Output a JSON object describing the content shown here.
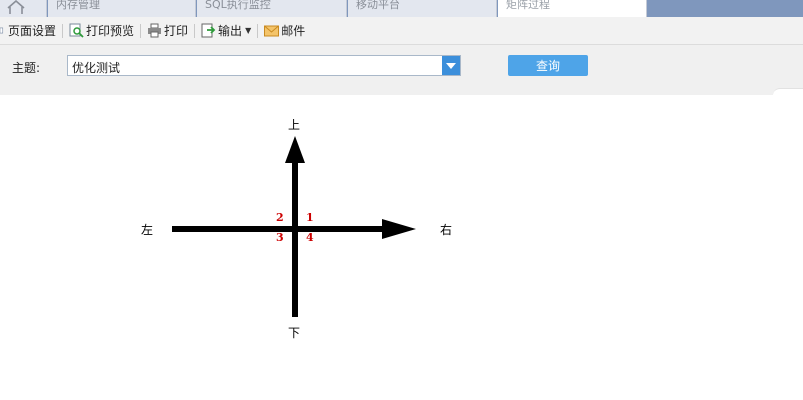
{
  "tabs": [
    {
      "label": ""
    },
    {
      "label": "内存管理"
    },
    {
      "label": "SQL执行监控"
    },
    {
      "label": "移动平台"
    },
    {
      "label": "矩阵过程"
    }
  ],
  "toolbar": {
    "page_setup": "页面设置",
    "print_preview": "打印预览",
    "print": "打印",
    "export": "输出",
    "mail": "邮件"
  },
  "filter": {
    "label": "主题:",
    "selected": "优化测试",
    "query_button": "查询"
  },
  "diagram": {
    "up": "上",
    "down": "下",
    "left": "左",
    "right": "右",
    "quadrants": [
      "1",
      "2",
      "3",
      "4"
    ]
  },
  "colors": {
    "accent": "#4ea4e8",
    "quadrant_number": "#cc0000",
    "tabbar": "#7f97bd"
  }
}
